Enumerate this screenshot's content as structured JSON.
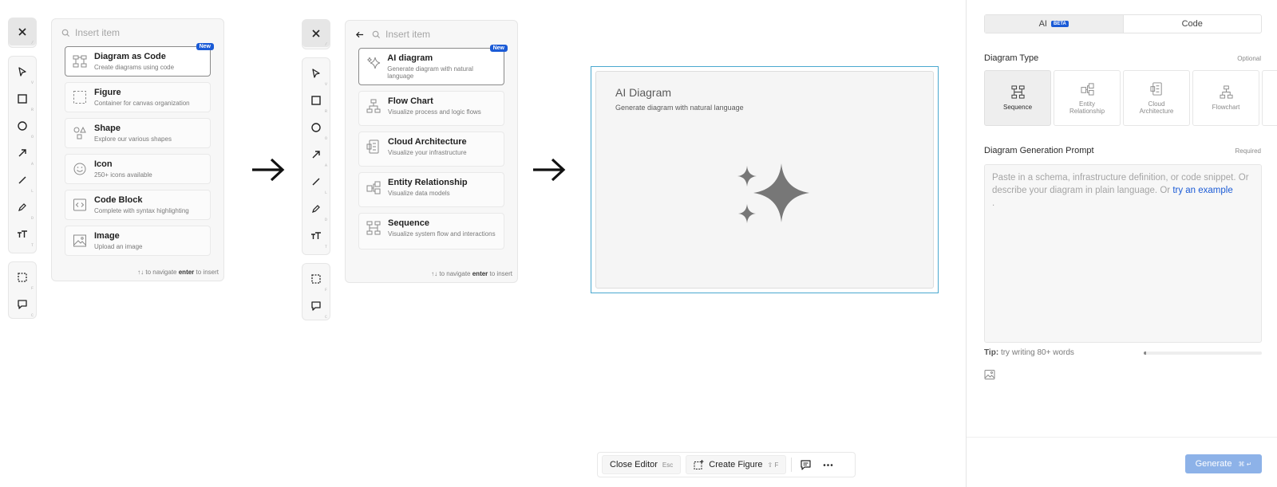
{
  "tools": [
    {
      "icon": "close-icon",
      "key": "/"
    },
    {
      "icon": "pointer-icon",
      "key": "V"
    },
    {
      "icon": "rectangle-icon",
      "key": "R"
    },
    {
      "icon": "circle-icon",
      "key": "O"
    },
    {
      "icon": "arrow-icon",
      "key": "A"
    },
    {
      "icon": "line-icon",
      "key": "L"
    },
    {
      "icon": "pencil-icon",
      "key": "D"
    },
    {
      "icon": "text-icon",
      "key": "T"
    },
    {
      "icon": "frame-select-icon",
      "key": "F"
    },
    {
      "icon": "comment-icon",
      "key": "C"
    }
  ],
  "panel1": {
    "search_placeholder": "Insert item",
    "badge": "New",
    "items": [
      {
        "title": "Diagram as Code",
        "desc": "Create diagrams using code",
        "icon": "diagram-code-icon"
      },
      {
        "title": "Figure",
        "desc": "Container for canvas organization",
        "icon": "figure-icon"
      },
      {
        "title": "Shape",
        "desc": "Explore our various shapes",
        "icon": "shapes-icon"
      },
      {
        "title": "Icon",
        "desc": "250+ icons available",
        "icon": "smiley-icon"
      },
      {
        "title": "Code Block",
        "desc": "Complete with syntax highlighting",
        "icon": "code-block-icon"
      },
      {
        "title": "Image",
        "desc": "Upload an image",
        "icon": "image-icon"
      }
    ],
    "foot_arrows": "↑↓",
    "foot_nav": "to navigate",
    "foot_enter": "enter",
    "foot_insert": "to insert"
  },
  "panel2": {
    "search_placeholder": "Insert item",
    "badge": "New",
    "items": [
      {
        "title": "AI diagram",
        "desc": "Generate diagram with natural language",
        "icon": "sparkle-icon"
      },
      {
        "title": "Flow Chart",
        "desc": "Visualize process and logic flows",
        "icon": "flowchart-icon"
      },
      {
        "title": "Cloud Architecture",
        "desc": "Visualize your infrastructure",
        "icon": "cloud-architecture-icon"
      },
      {
        "title": "Entity Relationship",
        "desc": "Visualize data models",
        "icon": "entity-relationship-icon"
      },
      {
        "title": "Sequence",
        "desc": "Visualize system flow and interactions",
        "icon": "sequence-icon"
      }
    ],
    "foot_arrows": "↑↓",
    "foot_nav": "to navigate",
    "foot_enter": "enter",
    "foot_insert": "to insert"
  },
  "canvas": {
    "title": "AI Diagram",
    "subtitle": "Generate diagram with natural language"
  },
  "bottom_bar": {
    "close_label": "Close Editor",
    "close_key": "Esc",
    "figure_label": "Create Figure",
    "figure_key": "⇧ F"
  },
  "right_panel": {
    "tab_ai": "AI",
    "tab_ai_badge": "BETA",
    "tab_code": "Code",
    "type_label": "Diagram Type",
    "type_hint": "Optional",
    "types": [
      {
        "label": "Sequence",
        "icon": "sequence-icon"
      },
      {
        "label": "Entity Relationship",
        "icon": "entity-relationship-icon"
      },
      {
        "label": "Cloud Architecture",
        "icon": "cloud-architecture-icon"
      },
      {
        "label": "Flowchart",
        "icon": "flowchart-icon"
      }
    ],
    "prompt_label": "Diagram Generation Prompt",
    "prompt_hint": "Required",
    "prompt_placeholder": "Paste in a schema, infrastructure definition, or code snippet. Or describe your diagram in plain language. Or",
    "prompt_link": "try an example",
    "prompt_end": ".",
    "tip_label": "Tip:",
    "tip_text": "try writing 80+ words",
    "tip_progress": 0.02,
    "generate_label": "Generate",
    "generate_key": "⌘ ↵"
  },
  "colors": {
    "accent": "#1b5bd6",
    "frame": "#4aa8cf",
    "generate": "#8db2e8"
  }
}
